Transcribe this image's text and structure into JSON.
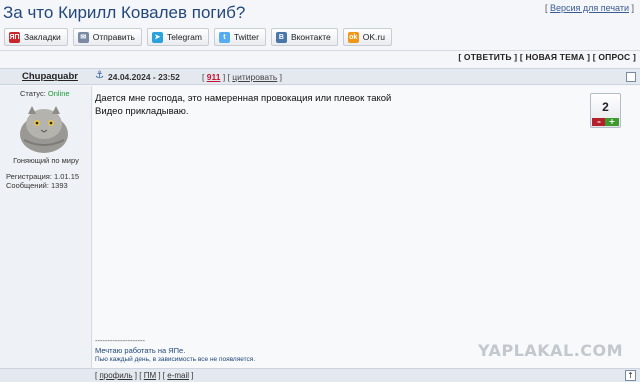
{
  "page": {
    "title": "За что Кирилл Ковалев погиб?",
    "print_prefix": "[ ",
    "print_link": "Версия для печати",
    "print_suffix": " ]"
  },
  "share": [
    {
      "label": "Закладки",
      "icon": "yapl-icon",
      "color": "#c8262c",
      "glyph": "ЯП"
    },
    {
      "label": "Отправить",
      "icon": "mail-icon",
      "color": "#7a8aa3",
      "glyph": "✉"
    },
    {
      "label": "Telegram",
      "icon": "telegram-icon",
      "color": "#2aa3dc",
      "glyph": "➤"
    },
    {
      "label": "Twitter",
      "icon": "twitter-icon",
      "color": "#55acee",
      "glyph": "t"
    },
    {
      "label": "Вконтакте",
      "icon": "vk-icon",
      "color": "#4a76a8",
      "glyph": "В"
    },
    {
      "label": "OK.ru",
      "icon": "ok-icon",
      "color": "#f29618",
      "glyph": "ok"
    }
  ],
  "actions": "[ ОТВЕТИТЬ ] [ НОВАЯ ТЕМА ] [ ОПРОС ]",
  "post": {
    "author": "Chupaquabr",
    "date": "24.04.2024 - 23:52",
    "meta_open": "[ ",
    "number": "911",
    "meta_mid": " ] [ ",
    "cite": "цитировать",
    "meta_close": " ]",
    "text_line1": "Дается мне господа, это намеренная провокация или плевок такой",
    "text_line2": "Видео прикладываю.",
    "rating": "2",
    "rating_minus": "–",
    "rating_plus": "+"
  },
  "user": {
    "status_label": "Статус: ",
    "status_value": "Online",
    "title": "Гоняющий по миру",
    "registration": "Регистрация: 1.01.15",
    "messages": "Сообщений: 1393"
  },
  "signature": {
    "dashes": "--------------------",
    "line1": "Мечтаю работать на ЯПе.",
    "line2": "Пью каждый день, в зависимость все не появляется."
  },
  "watermark": "YAPLAKAL.COM",
  "footer": {
    "open": "[ ",
    "profile": "профиль",
    "sep1": " ] [ ",
    "pm": "ПМ",
    "sep2": " ] [ ",
    "email": "e-mail",
    "close": " ]",
    "up_glyph": "↑"
  }
}
